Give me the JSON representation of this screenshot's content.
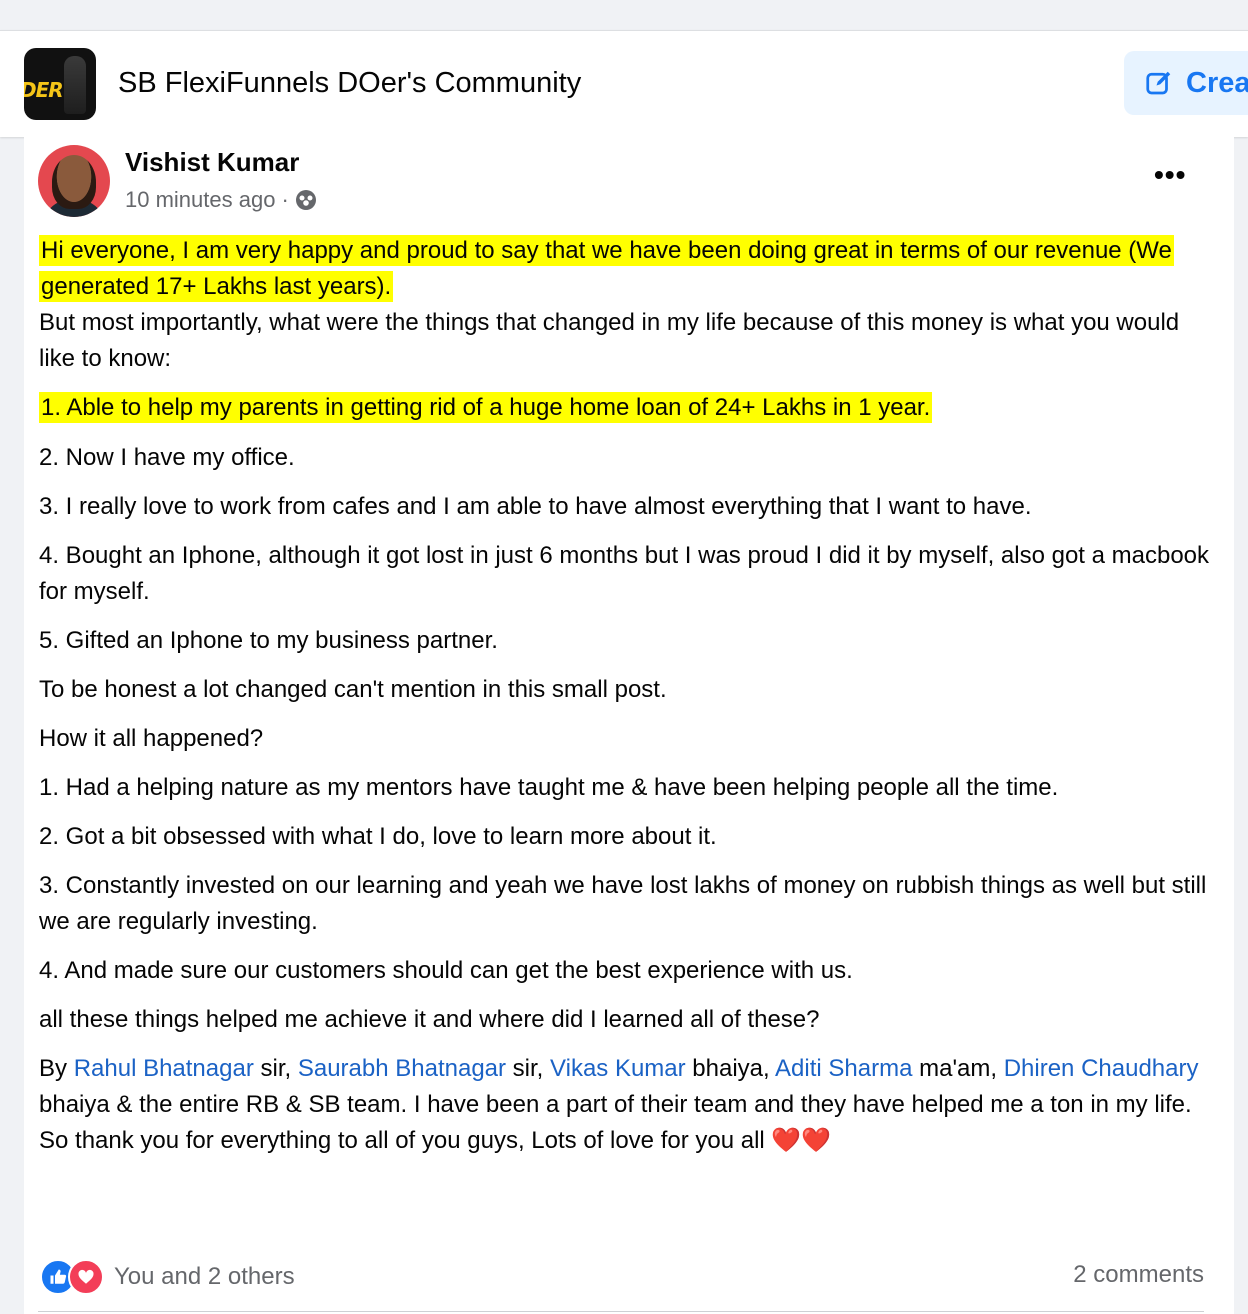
{
  "group": {
    "logo_text": "DER",
    "title": "SB FlexiFunnels DOer's Community",
    "create_label": "Crea"
  },
  "post": {
    "author": "Vishist Kumar",
    "time": "10 minutes ago",
    "separator": "·",
    "privacy_icon": "group-privacy-icon",
    "more_label": "•••",
    "intro_highlight_1": "Hi everyone, I am very happy and proud to say that we have been doing great in terms of our revenue (We generated 17+ Lakhs last years).",
    "intro_2": "But most importantly, what were the things that changed in my life because of this money is what you would like to know:",
    "changes": [
      "1. Able to help my parents in getting rid of a huge home loan of 24+ Lakhs in 1 year.",
      "2. Now I have my office.",
      "3. I really love to work from cafes and I am able to have almost everything that I want to have.",
      "4. Bought an Iphone, although it got lost in just 6 months but I was proud I did it by myself, also got a macbook for myself.",
      "5. Gifted an Iphone to my business partner."
    ],
    "honest": "To be honest a lot changed can't mention in this small post.",
    "how": "How it all happened?",
    "reasons": [
      "1. Had a helping nature as my mentors have taught me & have been helping people all the time.",
      "2. Got a bit obsessed with what I do, love to learn more about it.",
      "3. Constantly invested on our learning and yeah we have lost lakhs of money on rubbish things as well but still we are regularly investing.",
      "4. And made sure our customers should can get the best experience with us."
    ],
    "question": "all these things helped me achieve it and where did I learned all of these?",
    "by": "By",
    "mentions": {
      "rahul": "Rahul Bhatnagar",
      "saurabh": "Saurabh Bhatnagar",
      "vikas": "Vikas Kumar",
      "aditi": "Aditi Sharma",
      "dhiren": "Dhiren Chaudhary"
    },
    "sir1": " sir, ",
    "sir2": " sir, ",
    "bhaiya1": " bhaiya, ",
    "maam": " ma'am, ",
    "closing": " bhaiya & the entire RB & SB team. I have been a part of their team and they have helped me a ton in my life. So thank you for everything to all of you guys, Lots of love for you all ",
    "hearts": "❤️❤️",
    "reactions_text": "You and 2 others",
    "comments_text": "2 comments"
  },
  "colors": {
    "highlight": "#ffff00",
    "link": "#1b62c5",
    "like_blue": "#1877f2",
    "love_red": "#f33e58"
  }
}
